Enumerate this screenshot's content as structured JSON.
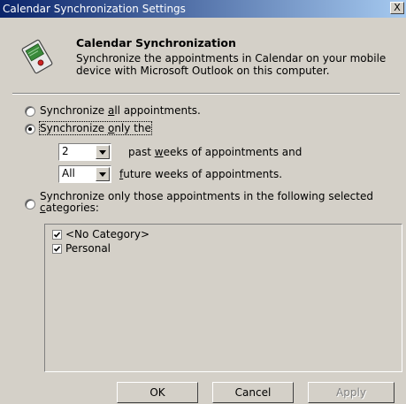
{
  "window": {
    "title": "Calendar Synchronization Settings",
    "close_glyph": "X"
  },
  "header": {
    "title": "Calendar Synchronization",
    "description": "Synchronize the appointments in Calendar on your mobile device with Microsoft Outlook on this computer.",
    "icon": "calendar-device-icon"
  },
  "options": {
    "all": {
      "pre": "Synchronize ",
      "key": "a",
      "post": "ll appointments."
    },
    "only": {
      "pre": "Synchronize ",
      "key": "o",
      "post": "nly the",
      "selected": true
    },
    "past": {
      "value": "2",
      "pre": "past ",
      "key": "w",
      "post": "eeks of appointments and"
    },
    "future": {
      "value": "All",
      "key": "f",
      "post": "uture weeks of appointments."
    },
    "categories": {
      "line1": "Synchronize only those appointments in the following selected",
      "key": "c",
      "line2_post": "ategories:"
    }
  },
  "category_list": [
    {
      "label": "<No Category>",
      "checked": true
    },
    {
      "label": "Personal",
      "checked": true
    }
  ],
  "buttons": {
    "ok": "OK",
    "cancel": "Cancel",
    "apply": "Apply"
  }
}
